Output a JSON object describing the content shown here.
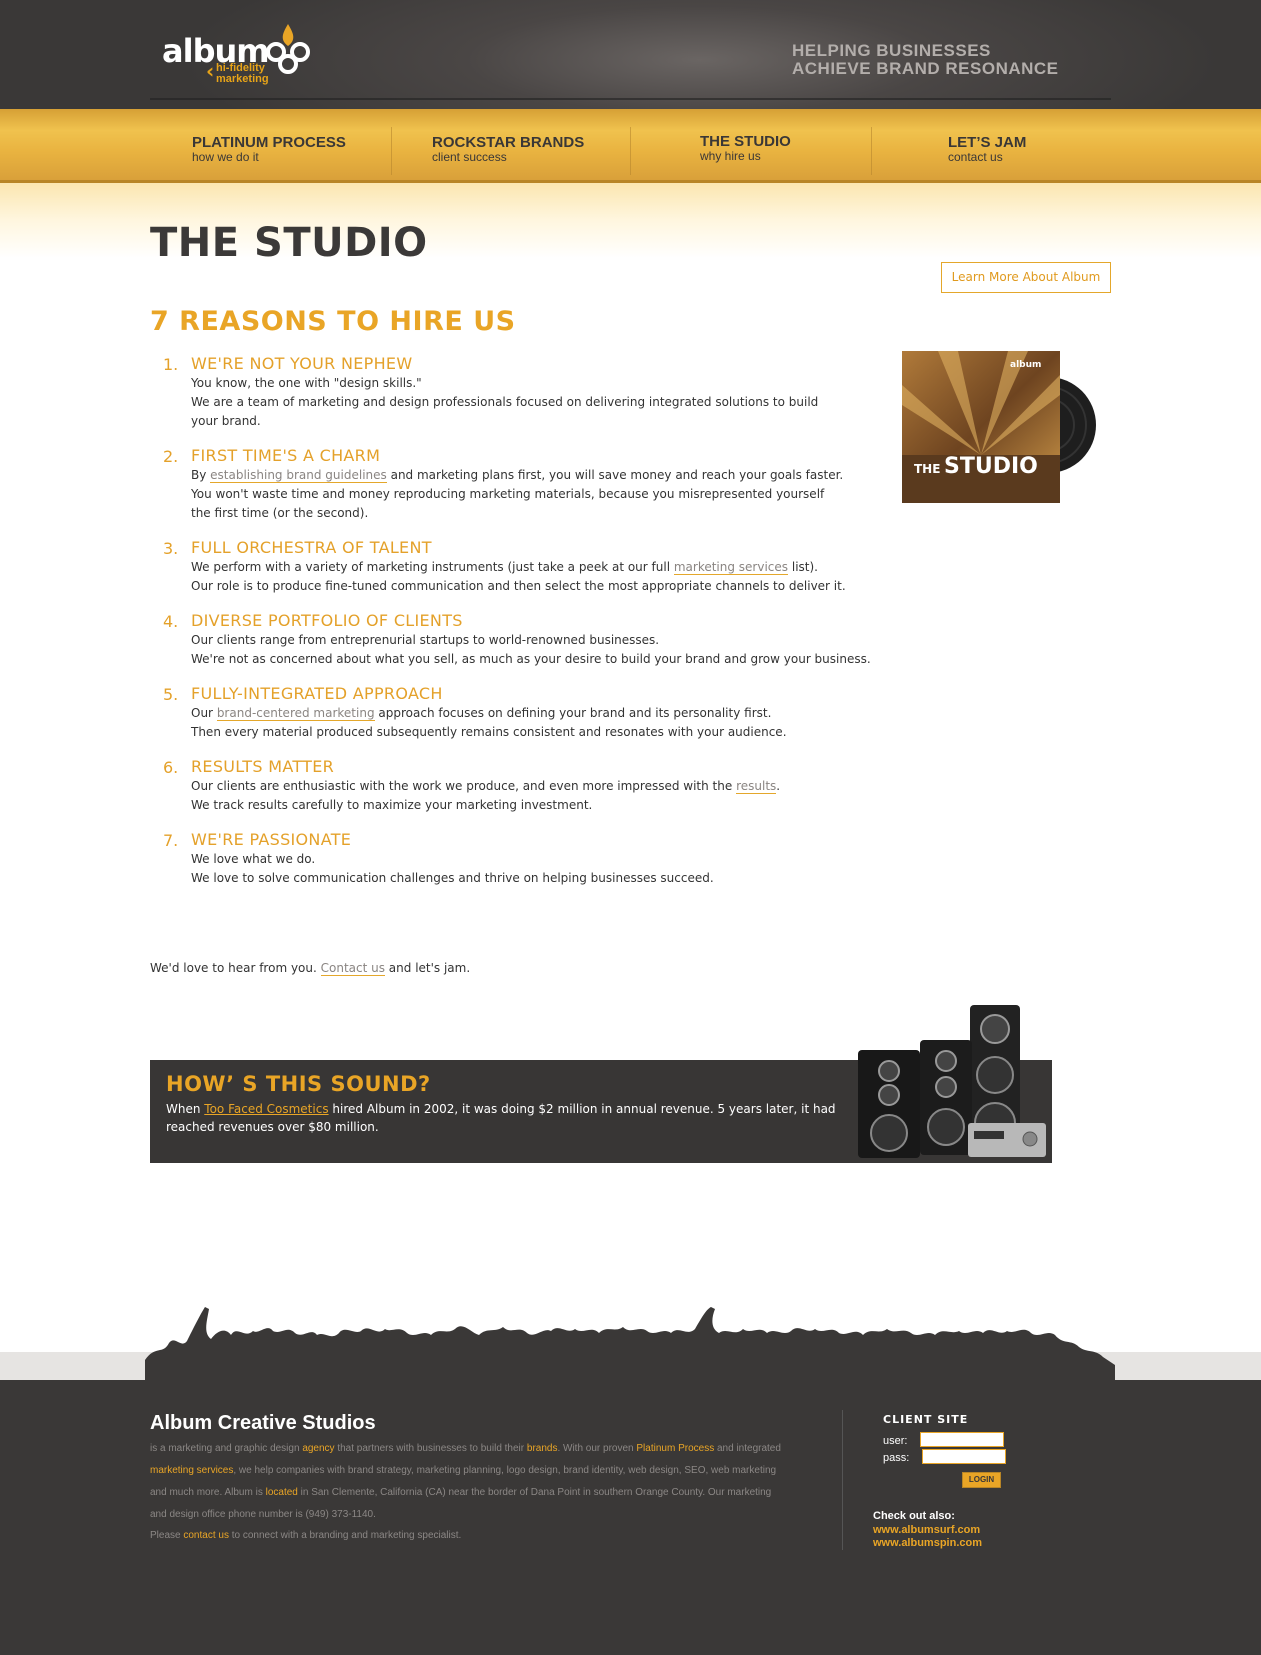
{
  "header": {
    "logo": {
      "word": "album",
      "sub1": "hi-fidelity",
      "sub2": "marketing"
    },
    "tagline": [
      "HELPING BUSINESSES",
      "ACHIEVE BRAND RESONANCE"
    ]
  },
  "nav": [
    {
      "title": "PLATINUM PROCESS",
      "sub": "how we do it"
    },
    {
      "title": "ROCKSTAR BRANDS",
      "sub": "client success"
    },
    {
      "title": "THE STUDIO",
      "sub": "why hire us"
    },
    {
      "title": "LET’S JAM",
      "sub": "contact us"
    }
  ],
  "main": {
    "title": "THE STUDIO",
    "learn_more": "Learn More About Album",
    "reasons_heading": "7 REASONS TO HIRE US",
    "album_art_text": "THE STUDIO",
    "reasons": [
      {
        "num": "1.",
        "title": "WE'RE NOT YOUR NEPHEW",
        "lines": [
          "You know, the one with \"design skills.\"",
          "We are a team of marketing and design professionals focused on delivering integrated solutions to build",
          "your brand."
        ]
      },
      {
        "num": "2.",
        "title": "FIRST TIME'S A CHARM",
        "pre": "By ",
        "link": "establishing brand guidelines",
        "post": " and marketing plans first, you will save money and reach your goals faster.",
        "lines": [
          "You won't waste time and money reproducing marketing materials, because you misrepresented yourself",
          "the first time (or the second)."
        ]
      },
      {
        "num": "3.",
        "title": "FULL ORCHESTRA OF TALENT",
        "pre": "We perform with a variety of marketing instruments (just take a peek at our full ",
        "link": "marketing services",
        "post": " list).",
        "lines": [
          "Our role is to produce fine-tuned communication and then select the most appropriate channels to deliver it."
        ]
      },
      {
        "num": "4.",
        "title": "DIVERSE PORTFOLIO OF CLIENTS",
        "lines": [
          "Our clients range from entreprenurial startups to world-renowned businesses.",
          "We're not as concerned about what you sell, as much as your desire to build your brand and grow your business."
        ]
      },
      {
        "num": "5.",
        "title": "FULLY-INTEGRATED APPROACH",
        "pre": "Our ",
        "link": "brand-centered marketing",
        "post": " approach focuses on defining your brand and its personality first.",
        "lines": [
          "Then every material produced subsequently remains consistent and resonates with your audience."
        ]
      },
      {
        "num": "6.",
        "title": "RESULTS MATTER",
        "pre": "Our clients are enthusiastic with the work we produce, and even more impressed with the ",
        "link": "results",
        "post": ".",
        "lines": [
          "We track results carefully to maximize your marketing investment."
        ]
      },
      {
        "num": "7.",
        "title": "WE'RE PASSIONATE",
        "lines": [
          "We love what we do.",
          "We love to solve communication challenges and thrive on helping businesses succeed."
        ]
      }
    ],
    "cta": {
      "pre": "We'd love to hear from you. ",
      "link": "Contact us",
      "post": " and let's jam."
    }
  },
  "sound": {
    "title": "HOW’ S THIS SOUND?",
    "pre": "When ",
    "link": "Too Faced Cosmetics",
    "post": " hired Album in 2002, it was doing $2 million in annual revenue. 5 years later, it had reached revenues over $80 million."
  },
  "footer": {
    "title": "Album Creative Studios",
    "body": [
      {
        "t": "is a marketing and graphic design "
      },
      {
        "t": "agency",
        "y": true
      },
      {
        "t": " that partners with businesses to build their "
      },
      {
        "t": "brands",
        "y": true
      },
      {
        "t": ". With our proven "
      },
      {
        "t": "Platinum Process",
        "y": true
      },
      {
        "t": " and integrated "
      },
      {
        "t": "marketing services",
        "y": true
      },
      {
        "t": ", we help companies with brand strategy, marketing planning, logo design, brand identity, web design, SEO, web marketing and much more. Album is "
      },
      {
        "t": "located",
        "y": true
      },
      {
        "t": " in San Clemente, California (CA) near the border of Dana Point in southern Orange County. Our marketing and design office phone number is (949) 373-1140."
      }
    ],
    "contact": {
      "pre": "Please ",
      "link": "contact us",
      "post": " to connect with a branding and marketing specialist."
    },
    "client": {
      "title": "CLIENT SITE",
      "user_label": "user:",
      "pass_label": "pass:",
      "login": "LOGIN"
    },
    "also": {
      "label": "Check out also:",
      "links": [
        "www.albumsurf.com",
        "www.albumspin.com"
      ]
    }
  },
  "colors": {
    "accent": "#e9a526",
    "dark": "#3a3837",
    "nav": "#f0c24e"
  }
}
